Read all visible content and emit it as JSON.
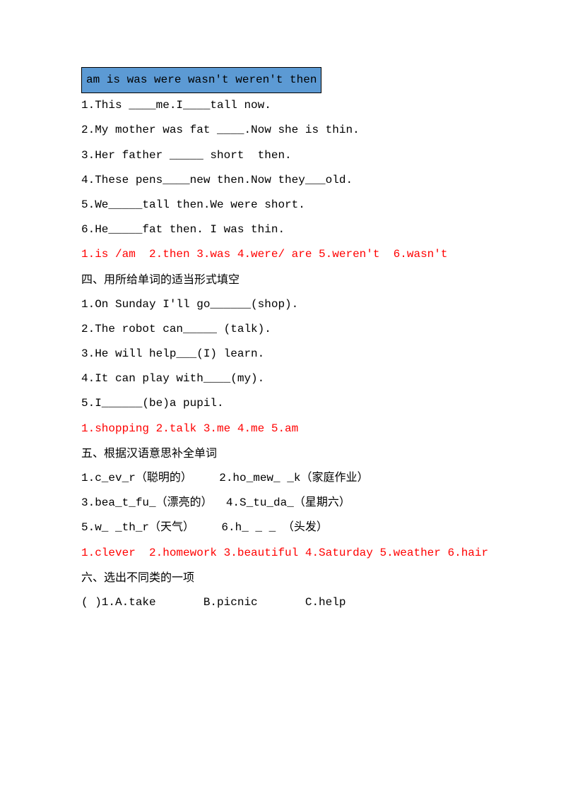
{
  "word_bank": "am  is   was   were   wasn't  weren't  then",
  "section3": {
    "q1": "1.This ____me.I____tall now.",
    "q2": "2.My mother was fat ____.Now she is thin.",
    "q3": "3.Her father _____ short  then.",
    "q4": "4.These pens____new then.Now they___old.",
    "q5": "5.We_____tall then.We were short.",
    "q6": "6.He_____fat then. I was thin.",
    "answers": "1.is /am  2.then 3.was 4.were/ are 5.weren't  6.wasn't"
  },
  "section4": {
    "title": "四、用所给单词的适当形式填空",
    "q1": "1.On Sunday I'll go______(shop).",
    "q2": "2.The robot can_____ (talk).",
    "q3": "3.He will help___(I) learn.",
    "q4": "4.It can play with____(my).",
    "q5": "5.I______(be)a pupil.",
    "answers": "1.shopping 2.talk 3.me 4.me 5.am"
  },
  "section5": {
    "title": "五、根据汉语意思补全单词",
    "row1": "1.c_ev_r（聪明的）    2.ho_mew_ _k（家庭作业）",
    "row2": "3.bea_t_fu_（漂亮的）  4.S_tu_da_（星期六）",
    "row3": "5.w_ _th_r（天气）    6.h_ _ _ （头发）",
    "answers": "1.clever  2.homework 3.beautiful 4.Saturday 5.weather 6.hair"
  },
  "section6": {
    "title": "六、选出不同类的一项",
    "q1": "( )1.A.take       B.picnic       C.help"
  }
}
